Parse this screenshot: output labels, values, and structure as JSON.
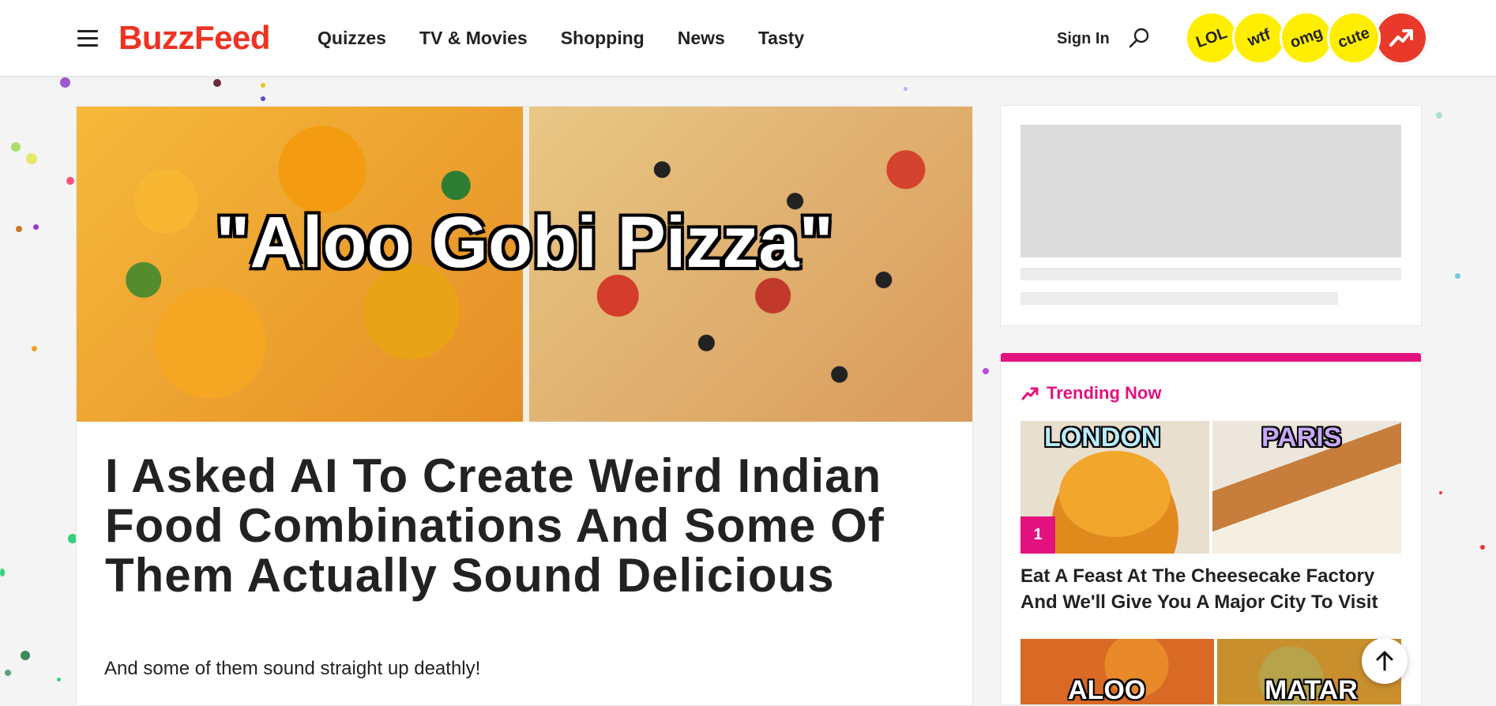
{
  "header": {
    "logo": "BuzzFeed",
    "nav": [
      "Quizzes",
      "TV & Movies",
      "Shopping",
      "News",
      "Tasty"
    ],
    "sign_in": "Sign In",
    "reaction_badges": [
      "LOL",
      "wtf",
      "omg",
      "cute"
    ]
  },
  "article": {
    "hero_text": "\"Aloo Gobi Pizza\"",
    "headline": "I Asked AI To Create Weird Indian Food Combinations And Some Of Them Actually Sound Delicious",
    "dek": "And some of them sound straight up deathly!"
  },
  "sidebar": {
    "trending_title": "Trending Now",
    "items": [
      {
        "rank": "1",
        "image_labels": [
          "LONDON",
          "PARIS"
        ],
        "title": "Eat A Feast At The Cheesecake Factory And We'll Give You A Major City To Visit"
      },
      {
        "image_labels": [
          "ALOO",
          "MATAR"
        ]
      }
    ]
  },
  "colors": {
    "brand_red": "#e32222",
    "trending_pink": "#e3127f",
    "badge_yellow": "#ffee00"
  },
  "icons": [
    "hamburger-icon",
    "search-icon",
    "trending-icon",
    "arrow-up-icon"
  ]
}
